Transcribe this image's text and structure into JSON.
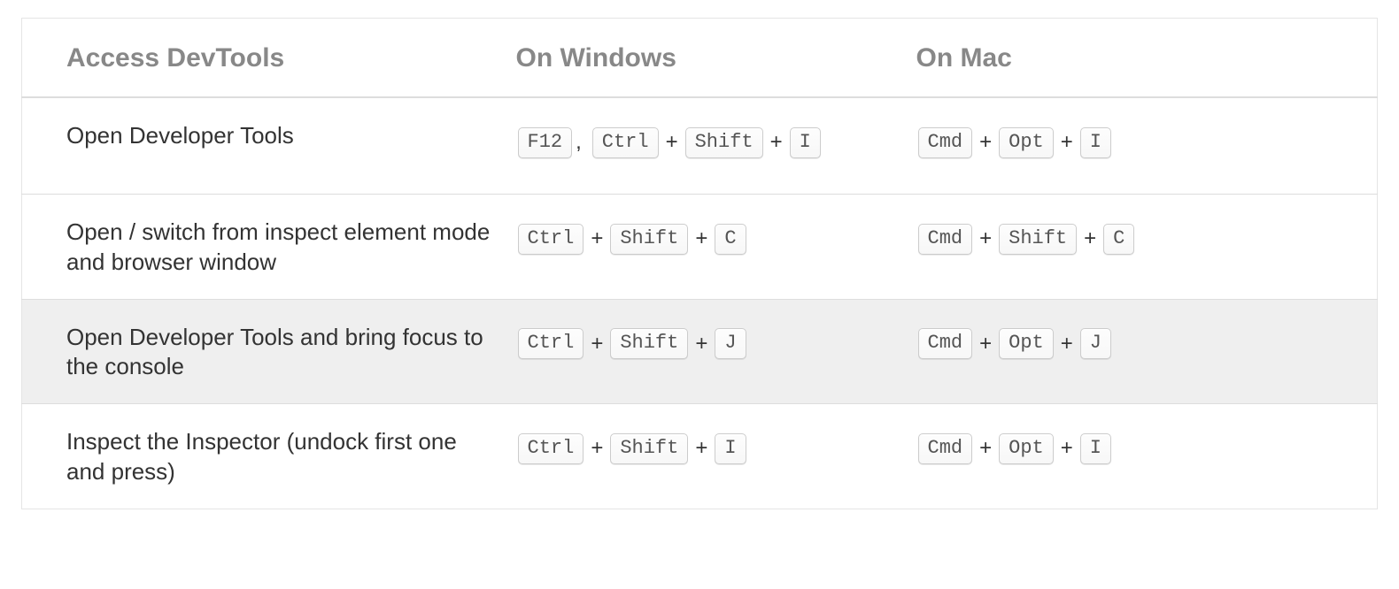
{
  "table": {
    "headers": {
      "action": "Access DevTools",
      "windows": "On Windows",
      "mac": "On Mac"
    },
    "rows": [
      {
        "highlight": false,
        "action": "Open Developer Tools",
        "windows": [
          {
            "type": "key",
            "text": "F12"
          },
          {
            "type": "sep",
            "text": ","
          },
          {
            "type": "key",
            "text": "Ctrl"
          },
          {
            "type": "sep",
            "text": "+"
          },
          {
            "type": "key",
            "text": "Shift"
          },
          {
            "type": "sep",
            "text": "+"
          },
          {
            "type": "key",
            "text": "I"
          }
        ],
        "mac": [
          {
            "type": "key",
            "text": "Cmd"
          },
          {
            "type": "sep",
            "text": "+"
          },
          {
            "type": "key",
            "text": "Opt"
          },
          {
            "type": "sep",
            "text": "+"
          },
          {
            "type": "key",
            "text": "I"
          }
        ]
      },
      {
        "highlight": false,
        "action": "Open / switch from inspect element mode and browser window",
        "windows": [
          {
            "type": "key",
            "text": "Ctrl"
          },
          {
            "type": "sep",
            "text": "+"
          },
          {
            "type": "key",
            "text": "Shift"
          },
          {
            "type": "sep",
            "text": "+"
          },
          {
            "type": "key",
            "text": "C"
          }
        ],
        "mac": [
          {
            "type": "key",
            "text": "Cmd"
          },
          {
            "type": "sep",
            "text": "+"
          },
          {
            "type": "key",
            "text": "Shift"
          },
          {
            "type": "sep",
            "text": "+"
          },
          {
            "type": "key",
            "text": "C"
          }
        ]
      },
      {
        "highlight": true,
        "action": "Open Developer Tools and bring focus to the console",
        "windows": [
          {
            "type": "key",
            "text": "Ctrl"
          },
          {
            "type": "sep",
            "text": "+"
          },
          {
            "type": "key",
            "text": "Shift"
          },
          {
            "type": "sep",
            "text": "+"
          },
          {
            "type": "key",
            "text": "J"
          }
        ],
        "mac": [
          {
            "type": "key",
            "text": "Cmd"
          },
          {
            "type": "sep",
            "text": "+"
          },
          {
            "type": "key",
            "text": "Opt"
          },
          {
            "type": "sep",
            "text": "+"
          },
          {
            "type": "key",
            "text": "J"
          }
        ]
      },
      {
        "highlight": false,
        "action": "Inspect the Inspector (undock first one and press)",
        "windows": [
          {
            "type": "key",
            "text": "Ctrl"
          },
          {
            "type": "sep",
            "text": "+"
          },
          {
            "type": "key",
            "text": "Shift"
          },
          {
            "type": "sep",
            "text": "+"
          },
          {
            "type": "key",
            "text": "I"
          }
        ],
        "mac": [
          {
            "type": "key",
            "text": "Cmd"
          },
          {
            "type": "sep",
            "text": "+"
          },
          {
            "type": "key",
            "text": "Opt"
          },
          {
            "type": "sep",
            "text": "+"
          },
          {
            "type": "key",
            "text": "I"
          }
        ]
      }
    ]
  }
}
